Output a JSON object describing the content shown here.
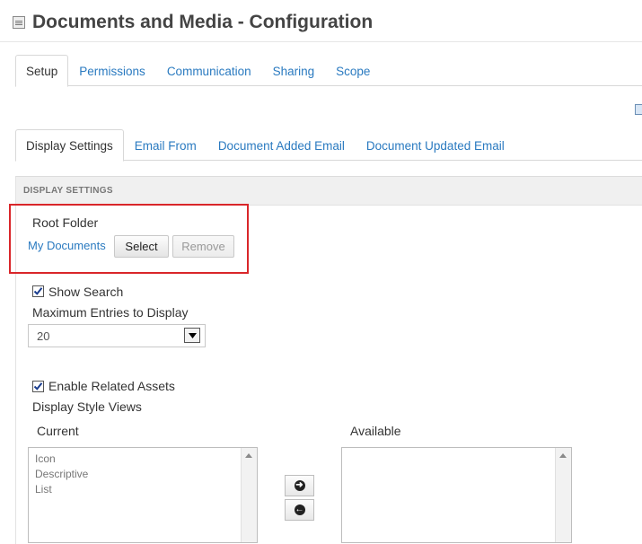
{
  "header": {
    "title": "Documents and Media - Configuration"
  },
  "top_tabs": [
    {
      "label": "Setup"
    },
    {
      "label": "Permissions"
    },
    {
      "label": "Communication"
    },
    {
      "label": "Sharing"
    },
    {
      "label": "Scope"
    }
  ],
  "sub_tabs": [
    {
      "label": "Display Settings"
    },
    {
      "label": "Email From"
    },
    {
      "label": "Document Added Email"
    },
    {
      "label": "Document Updated Email"
    }
  ],
  "panel": {
    "header": "DISPLAY SETTINGS"
  },
  "root_folder": {
    "label": "Root Folder",
    "value": "My Documents",
    "select_label": "Select",
    "remove_label": "Remove"
  },
  "show_search": {
    "label": "Show Search",
    "checked": true
  },
  "max_entries": {
    "label": "Maximum Entries to Display",
    "value": "20"
  },
  "related_assets": {
    "label": "Enable Related Assets",
    "checked": true
  },
  "display_style": {
    "label": "Display Style Views",
    "current_label": "Current",
    "available_label": "Available",
    "current_items": [
      "Icon",
      "Descriptive",
      "List"
    ],
    "available_items": []
  },
  "colors": {
    "link": "#2a7ac0",
    "highlight": "#d9262a"
  }
}
